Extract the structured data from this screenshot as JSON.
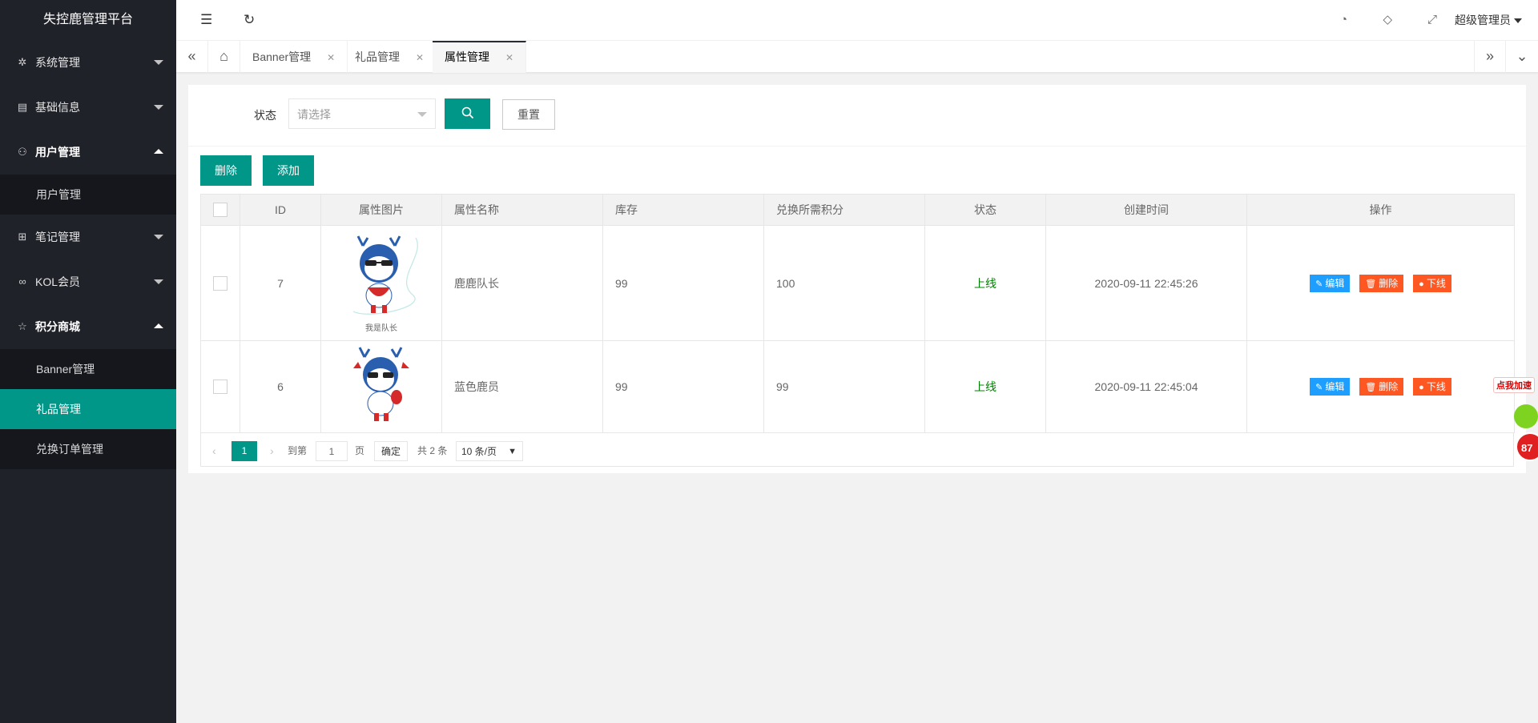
{
  "app": {
    "title": "失控鹿管理平台"
  },
  "sidebar": {
    "items": [
      {
        "label": "系统管理",
        "icon": "gear-icon",
        "open": false
      },
      {
        "label": "基础信息",
        "icon": "document-icon",
        "open": false
      },
      {
        "label": "用户管理",
        "icon": "user-icon",
        "open": true,
        "children": [
          {
            "label": "用户管理"
          }
        ]
      },
      {
        "label": "笔记管理",
        "icon": "notes-icon",
        "open": false
      },
      {
        "label": "KOL会员",
        "icon": "link-icon",
        "open": false
      },
      {
        "label": "积分商城",
        "icon": "star-icon",
        "open": true,
        "children": [
          {
            "label": "Banner管理"
          },
          {
            "label": "礼品管理",
            "active": true
          },
          {
            "label": "兑换订单管理"
          }
        ]
      }
    ]
  },
  "header": {
    "user": "超级管理员"
  },
  "tabs": [
    {
      "label": "Banner管理"
    },
    {
      "label": "礼品管理"
    },
    {
      "label": "属性管理",
      "active": true
    }
  ],
  "search": {
    "status_label": "状态",
    "status_placeholder": "请选择",
    "reset_label": "重置"
  },
  "toolbar": {
    "delete_label": "删除",
    "add_label": "添加"
  },
  "table": {
    "headers": [
      "ID",
      "属性图片",
      "属性名称",
      "库存",
      "兑换所需积分",
      "状态",
      "创建时间",
      "操作"
    ],
    "rows": [
      {
        "id": "7",
        "image_caption": "我是队长",
        "name": "鹿鹿队长",
        "stock": "99",
        "points": "100",
        "status": "上线",
        "created": "2020-09-11 22:45:26"
      },
      {
        "id": "6",
        "image_caption": "",
        "name": "蓝色鹿员",
        "stock": "99",
        "points": "99",
        "status": "上线",
        "created": "2020-09-11 22:45:04"
      }
    ],
    "actions": {
      "edit": "编辑",
      "delete": "删除",
      "offline": "下线"
    }
  },
  "pager": {
    "current": "1",
    "goto_label": "到第",
    "goto_value": "1",
    "page_unit": "页",
    "confirm": "确定",
    "total": "共 2 条",
    "page_size": "10 条/页"
  },
  "float_widget": {
    "label": "点我加速",
    "count": "87"
  },
  "colors": {
    "sidebar_bg": "#20222a",
    "accent": "#009688",
    "edit_btn": "#1e9fff",
    "danger_btn": "#ff5722",
    "status_on": "#008000"
  }
}
